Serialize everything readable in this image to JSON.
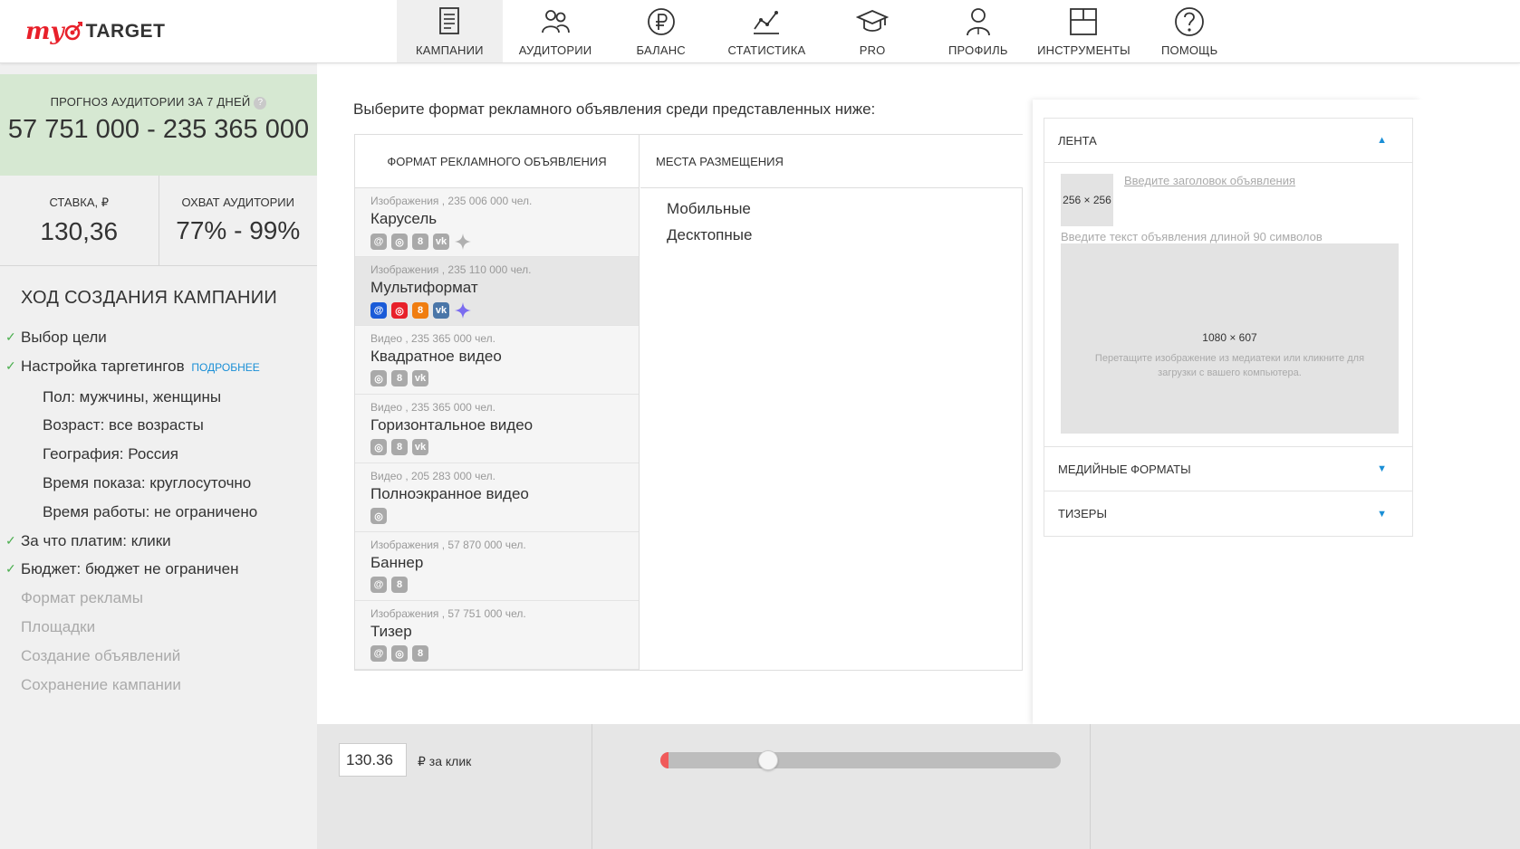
{
  "logo": {
    "my": "my",
    "target": "TARGET"
  },
  "nav": [
    {
      "label": "КАМПАНИИ",
      "icon": "campaigns-icon",
      "active": true
    },
    {
      "label": "АУДИТОРИИ",
      "icon": "audiences-icon"
    },
    {
      "label": "БАЛАНС",
      "icon": "ruble-icon"
    },
    {
      "label": "СТАТИСТИКА",
      "icon": "statistics-icon"
    },
    {
      "label": "PRO",
      "icon": "graduation-cap-icon"
    },
    {
      "label": "ПРОФИЛЬ",
      "icon": "profile-icon"
    },
    {
      "label": "ИНСТРУМЕНТЫ",
      "icon": "tools-icon"
    },
    {
      "label": "ПОМОЩЬ",
      "icon": "help-icon"
    }
  ],
  "forecast": {
    "caption": "ПРОГНОЗ АУДИТОРИИ ЗА 7 ДНЕЙ",
    "help": "?",
    "value": "57 751 000 - 235 365 000"
  },
  "stats": {
    "bid_caption": "СТАВКА, ₽",
    "bid_value": "130,36",
    "reach_caption": "ОХВАТ АУДИТОРИИ",
    "reach_value": "77% - 99%"
  },
  "steps": {
    "title": "ХОД СОЗДАНИЯ КАМПАНИИ",
    "more_label": "ПОДРОБНЕЕ",
    "items": [
      {
        "text": "Выбор цели",
        "state": "done"
      },
      {
        "text": "Настройка таргетингов",
        "state": "done",
        "more": true
      },
      {
        "text": "Пол: мужчины, женщины",
        "state": "sub"
      },
      {
        "text": "Возраст: все возрасты",
        "state": "sub"
      },
      {
        "text": "География: Россия",
        "state": "sub"
      },
      {
        "text": "Время показа: круглосуточно",
        "state": "sub"
      },
      {
        "text": "Время работы: не ограничено",
        "state": "sub"
      },
      {
        "text": "За что платим: клики",
        "state": "done"
      },
      {
        "text": "Бюджет: бюджет не ограничен",
        "state": "done"
      },
      {
        "text": "Формат рекламы",
        "state": "pending"
      },
      {
        "text": "Площадки",
        "state": "pending"
      },
      {
        "text": "Создание объявлений",
        "state": "pending"
      },
      {
        "text": "Сохранение кампании",
        "state": "pending"
      }
    ]
  },
  "main": {
    "intro": "Выберите формат рекламного объявления среди представленных ниже:",
    "format_col_header": "ФОРМАТ РЕКЛАМНОГО ОБЪЯВЛЕНИЯ",
    "placement_col_header": "МЕСТА РАЗМЕЩЕНИЯ",
    "formats": [
      {
        "meta": "Изображения , 235 006 000 чел.",
        "name": "Карусель",
        "platforms": [
          "mail",
          "mytarget",
          "ok",
          "vk",
          "sparkle"
        ],
        "selected": false
      },
      {
        "meta": "Изображения , 235 110 000 чел.",
        "name": "Мультиформат",
        "platforms": [
          "mail",
          "mytarget",
          "ok",
          "vk",
          "sparkle"
        ],
        "selected": true
      },
      {
        "meta": "Видео , 235 365 000 чел.",
        "name": "Квадратное видео",
        "platforms": [
          "mytarget",
          "ok",
          "vk"
        ],
        "selected": false
      },
      {
        "meta": "Видео , 235 365 000 чел.",
        "name": "Горизонтальное видео",
        "platforms": [
          "mytarget",
          "ok",
          "vk"
        ],
        "selected": false
      },
      {
        "meta": "Видео , 205 283 000 чел.",
        "name": "Полноэкранное видео",
        "platforms": [
          "mytarget"
        ],
        "selected": false
      },
      {
        "meta": "Изображения , 57 870 000 чел.",
        "name": "Баннер",
        "platforms": [
          "mail",
          "ok"
        ],
        "selected": false
      },
      {
        "meta": "Изображения , 57 751 000 чел.",
        "name": "Тизер",
        "platforms": [
          "mail",
          "mytarget",
          "ok"
        ],
        "selected": false
      }
    ],
    "placements": [
      "Мобильные",
      "Десктопные"
    ]
  },
  "preview": {
    "sections": [
      {
        "label": "ЛЕНТА",
        "expanded": true
      },
      {
        "label": "МЕДИЙНЫЕ ФОРМАТЫ",
        "expanded": false
      },
      {
        "label": "ТИЗЕРЫ",
        "expanded": false
      }
    ],
    "thumb_size": "256 × 256",
    "title_placeholder": "Введите заголовок объявления",
    "text_placeholder": "Введите текст объявления длиной 90 символов",
    "image_size": "1080 × 607",
    "image_hint": "Перетащите изображение из медиатеки или кликните для загрузки с вашего компьютера."
  },
  "bottom": {
    "bid_value": "130.36",
    "bid_unit": "₽ за клик",
    "slider_fraction": 0.27
  },
  "colors": {
    "accent": "#1a8fd6",
    "brand": "#e8202a",
    "forecast_bg": "#d6e8d2",
    "check": "#4caf50",
    "slider_low": "#f05a5a"
  }
}
